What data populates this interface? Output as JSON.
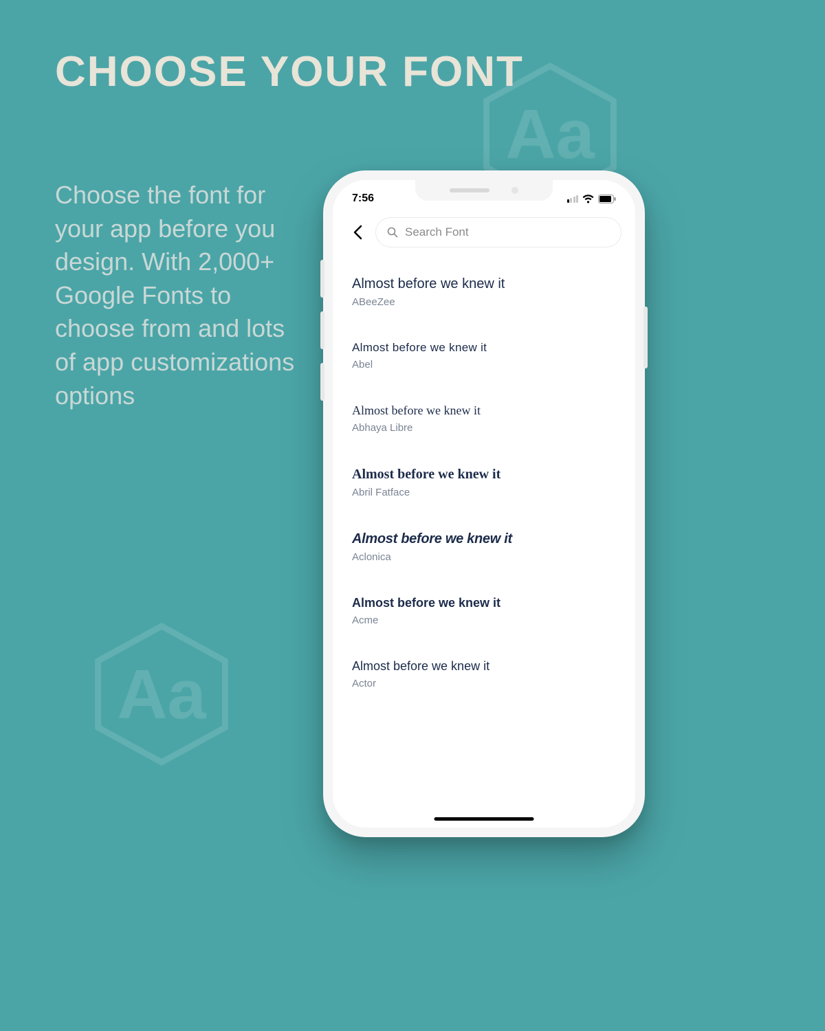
{
  "marketing": {
    "title": "CHOOSE YOUR FONT",
    "subtitle": "Choose the font for your app before you design. With 2,000+ Google Fonts to choose from and lots of app customizations options"
  },
  "status_bar": {
    "time": "7:56"
  },
  "search": {
    "placeholder": "Search Font"
  },
  "preview_text": "Almost before we knew it",
  "fonts": [
    {
      "name": "ABeeZee",
      "class": "f-abeezee"
    },
    {
      "name": "Abel",
      "class": "f-abel"
    },
    {
      "name": "Abhaya Libre",
      "class": "f-abhaya"
    },
    {
      "name": "Abril Fatface",
      "class": "f-abril"
    },
    {
      "name": "Aclonica",
      "class": "f-aclonica"
    },
    {
      "name": "Acme",
      "class": "f-acme"
    },
    {
      "name": "Actor",
      "class": "f-actor"
    }
  ]
}
